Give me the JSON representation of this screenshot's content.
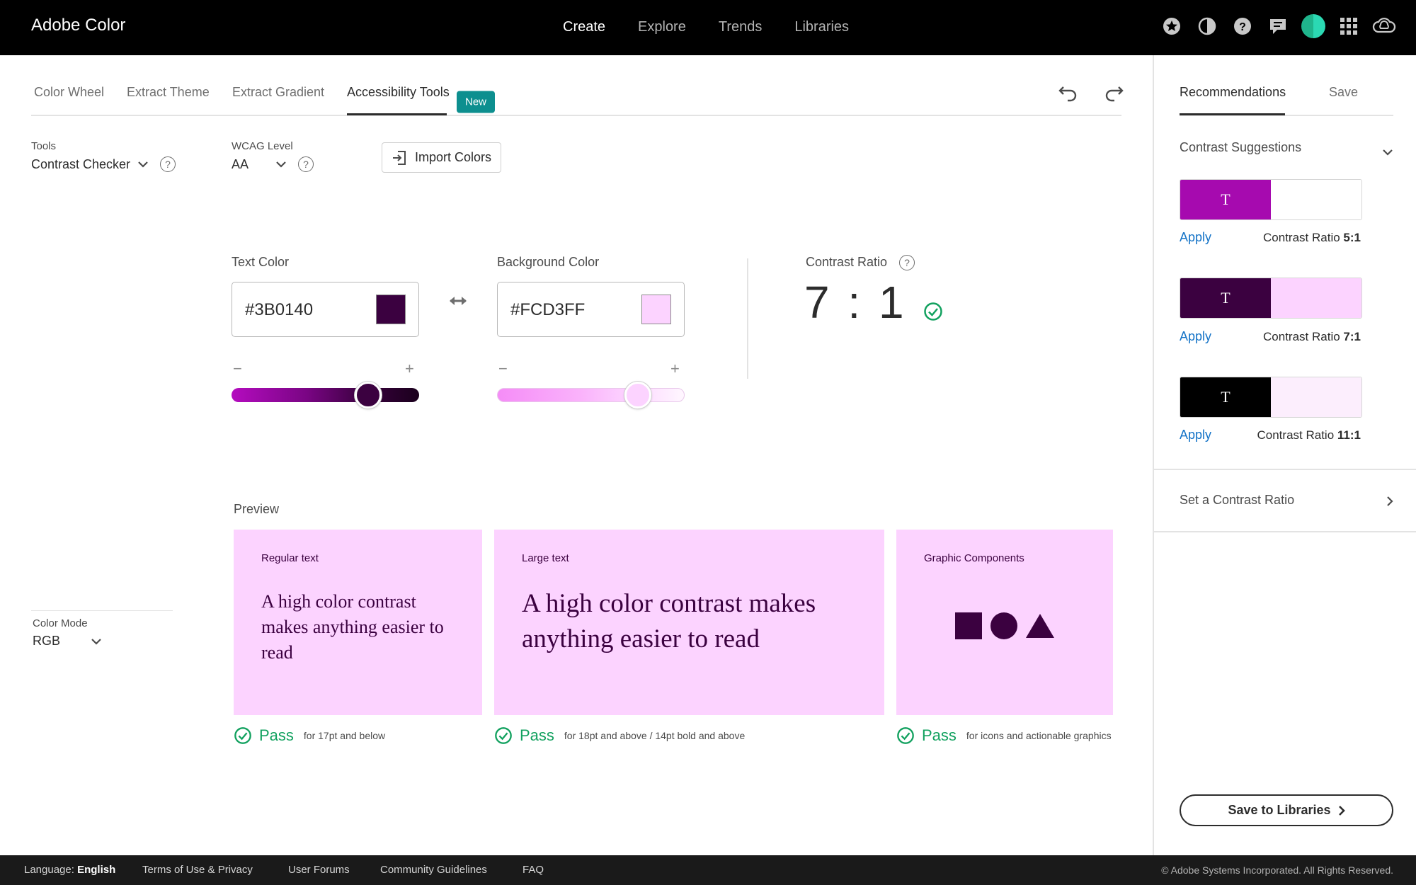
{
  "app": {
    "brand": "Adobe Color"
  },
  "topnav": [
    {
      "label": "Create",
      "active": true
    },
    {
      "label": "Explore",
      "active": false
    },
    {
      "label": "Trends",
      "active": false
    },
    {
      "label": "Libraries",
      "active": false
    }
  ],
  "topicons": [
    "star-icon",
    "contrast-icon",
    "help-icon",
    "feedback-icon",
    "avatar",
    "apps-grid-icon",
    "creative-cloud-icon"
  ],
  "tabs": {
    "items": [
      "Color Wheel",
      "Extract Theme",
      "Extract Gradient",
      "Accessibility Tools"
    ],
    "active": "Accessibility Tools",
    "new_badge": "New"
  },
  "tools": {
    "label": "Tools",
    "value": "Contrast Checker"
  },
  "wcag": {
    "label": "WCAG Level",
    "value": "AA"
  },
  "import_label": "Import Colors",
  "text_color": {
    "label": "Text Color",
    "hex": "#3B0140",
    "slider_level": 0.73
  },
  "background_color": {
    "label": "Background Color",
    "hex": "#FCD3FF",
    "slider_level": 0.75
  },
  "contrast": {
    "label": "Contrast Ratio",
    "value": "7 : 1"
  },
  "preview": {
    "label": "Preview",
    "regular": {
      "title": "Regular text",
      "text": "A high color contrast makes anything easier to read"
    },
    "large": {
      "title": "Large text",
      "text": "A high color contrast makes anything easier to read"
    },
    "graphic": {
      "title": "Graphic Components"
    }
  },
  "pass": [
    {
      "word": "Pass",
      "note": "for 17pt and below"
    },
    {
      "word": "Pass",
      "note": "for 18pt and above / 14pt bold and above"
    },
    {
      "word": "Pass",
      "note": "for icons and actionable graphics"
    }
  ],
  "color_mode": {
    "label": "Color Mode",
    "value": "RGB"
  },
  "right_panel": {
    "tabs": [
      "Recommendations",
      "Save"
    ],
    "suggestions_title": "Contrast Suggestions",
    "suggestions": [
      {
        "letter": "T",
        "text_color": "#A60AAF",
        "bg_color": "#FFFFFF",
        "apply": "Apply",
        "ratio_prefix": "Contrast Ratio",
        "ratio": "5:1"
      },
      {
        "letter": "T",
        "text_color": "#3B0140",
        "bg_color": "#FCD3FF",
        "apply": "Apply",
        "ratio_prefix": "Contrast Ratio",
        "ratio": "7:1"
      },
      {
        "letter": "T",
        "text_color": "#000000",
        "bg_color": "#FCEEFD",
        "apply": "Apply",
        "ratio_prefix": "Contrast Ratio",
        "ratio": "11:1"
      }
    ],
    "set_ratio": "Set a Contrast Ratio",
    "save_button": "Save to Libraries"
  },
  "footer": {
    "language_label": "Language:",
    "language_value": "English",
    "links": [
      "Terms of Use & Privacy",
      "User Forums",
      "Community Guidelines",
      "FAQ"
    ],
    "copyright": "© Adobe Systems Incorporated. All Rights Reserved."
  },
  "colors": {
    "accent_teal": "#0d8f8f",
    "pass_green": "#12a15f",
    "link_blue": "#1473c7"
  }
}
